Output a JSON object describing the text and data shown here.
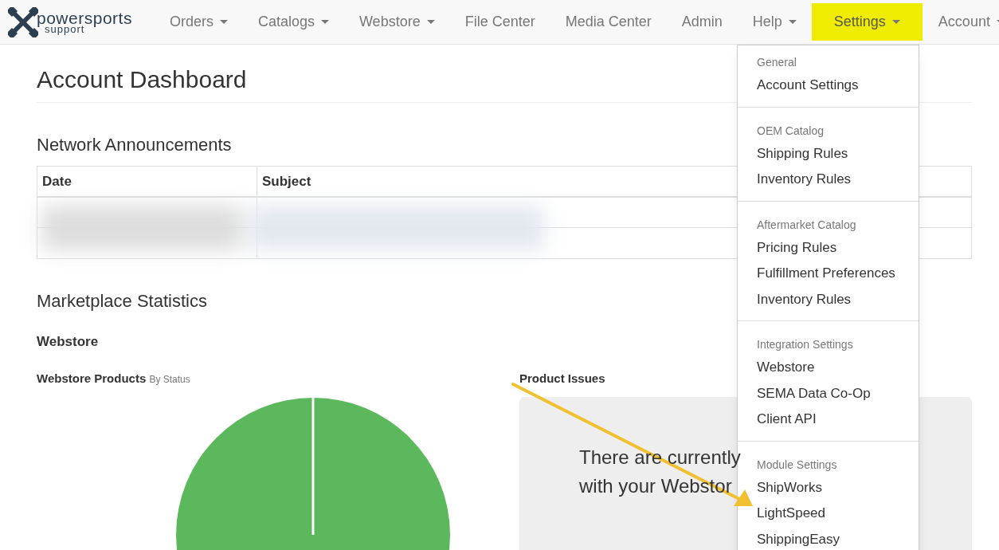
{
  "nav": {
    "brand": {
      "name": "powersports",
      "tagline": "support"
    },
    "items": [
      {
        "label": "Orders",
        "has_menu": true,
        "highlighted": false
      },
      {
        "label": "Catalogs",
        "has_menu": true,
        "highlighted": false
      },
      {
        "label": "Webstore",
        "has_menu": true,
        "highlighted": false
      },
      {
        "label": "File Center",
        "has_menu": false,
        "highlighted": false
      },
      {
        "label": "Media Center",
        "has_menu": false,
        "highlighted": false
      },
      {
        "label": "Admin",
        "has_menu": false,
        "highlighted": false
      },
      {
        "label": "Help",
        "has_menu": true,
        "highlighted": false
      },
      {
        "label": "Settings",
        "has_menu": true,
        "highlighted": true
      },
      {
        "label": "Account",
        "has_menu": true,
        "highlighted": false
      }
    ]
  },
  "page_title": "Account Dashboard",
  "announcements": {
    "title": "Network Announcements",
    "columns": [
      "Date",
      "Subject"
    ]
  },
  "statistics": {
    "title": "Marketplace Statistics",
    "subtitle": "Webstore",
    "products_panel": {
      "title": "Webstore Products",
      "note": "By Status"
    },
    "issues_panel": {
      "title": "Product Issues",
      "message_lines": [
        "There are currently",
        "with your Webstor"
      ]
    }
  },
  "settings_menu": {
    "sections": [
      {
        "header": "General",
        "items": [
          "Account Settings"
        ]
      },
      {
        "header": "OEM Catalog",
        "items": [
          "Shipping Rules",
          "Inventory Rules"
        ]
      },
      {
        "header": "Aftermarket Catalog",
        "items": [
          "Pricing Rules",
          "Fulfillment Preferences",
          "Inventory Rules"
        ]
      },
      {
        "header": "Integration Settings",
        "items": [
          "Webstore",
          "SEMA Data Co-Op",
          "Client API"
        ]
      },
      {
        "header": "Module Settings",
        "items": [
          "ShipWorks",
          "LightSpeed",
          "ShippingEasy"
        ]
      }
    ]
  }
}
